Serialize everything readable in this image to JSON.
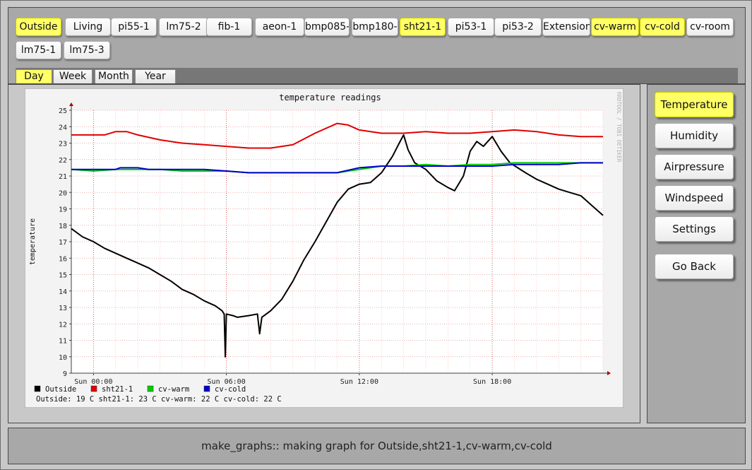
{
  "sensors": [
    {
      "label": "Outside",
      "active": true
    },
    {
      "label": "Living",
      "active": false
    },
    {
      "label": "pi55-1",
      "active": false
    },
    {
      "label": "lm75-2",
      "active": false
    },
    {
      "label": "fib-1",
      "active": false
    },
    {
      "label": "aeon-1",
      "active": false
    },
    {
      "label": "bmp085-",
      "active": false
    },
    {
      "label": "bmp180-",
      "active": false
    },
    {
      "label": "sht21-1",
      "active": true
    },
    {
      "label": "pi53-1",
      "active": false
    },
    {
      "label": "pi53-2",
      "active": false
    },
    {
      "label": "Extension",
      "active": false
    },
    {
      "label": "cv-warm",
      "active": true
    },
    {
      "label": "cv-cold",
      "active": true
    },
    {
      "label": "cv-room",
      "active": false
    },
    {
      "label": "lm75-1",
      "active": false
    },
    {
      "label": "lm75-3",
      "active": false
    }
  ],
  "tabs": [
    {
      "label": "Day",
      "active": true
    },
    {
      "label": "Week",
      "active": false
    },
    {
      "label": "Month",
      "active": false
    },
    {
      "label": "Year",
      "active": false
    }
  ],
  "side_buttons": [
    {
      "label": "Temperature",
      "active": true
    },
    {
      "label": "Humidity",
      "active": false
    },
    {
      "label": "Airpressure",
      "active": false
    },
    {
      "label": "Windspeed",
      "active": false
    },
    {
      "label": "Settings",
      "active": false
    },
    {
      "label": "Go Back",
      "active": false
    }
  ],
  "status_text": "make_graphs:: making graph for Outside,sht21-1,cv-warm,cv-cold",
  "chart_data": {
    "type": "line",
    "title": "temperature readings",
    "ylabel": "temperature",
    "watermark": "RRDTOOL / TOBI OETIKER",
    "ylim": [
      9,
      25
    ],
    "y_ticks": [
      9,
      10,
      11,
      12,
      13,
      14,
      15,
      16,
      17,
      18,
      19,
      20,
      21,
      22,
      23,
      24,
      25
    ],
    "x_range_hours": [
      -1,
      23
    ],
    "x_ticks": [
      {
        "hour": 0,
        "label": "Sun 00:00"
      },
      {
        "hour": 6,
        "label": "Sun 06:00"
      },
      {
        "hour": 12,
        "label": "Sun 12:00"
      },
      {
        "hour": 18,
        "label": "Sun 18:00"
      }
    ],
    "series": [
      {
        "name": "Outside",
        "color": "#000000",
        "points": [
          [
            -1,
            17.8
          ],
          [
            -0.5,
            17.3
          ],
          [
            0,
            17.0
          ],
          [
            0.5,
            16.6
          ],
          [
            1,
            16.3
          ],
          [
            1.5,
            16.0
          ],
          [
            2,
            15.7
          ],
          [
            2.5,
            15.4
          ],
          [
            3,
            15.0
          ],
          [
            3.5,
            14.6
          ],
          [
            4,
            14.1
          ],
          [
            4.5,
            13.8
          ],
          [
            5,
            13.4
          ],
          [
            5.5,
            13.1
          ],
          [
            5.8,
            12.8
          ],
          [
            5.9,
            12.6
          ],
          [
            5.95,
            10.0
          ],
          [
            6.0,
            12.6
          ],
          [
            6.3,
            12.5
          ],
          [
            6.5,
            12.4
          ],
          [
            7,
            12.5
          ],
          [
            7.4,
            12.6
          ],
          [
            7.5,
            11.4
          ],
          [
            7.6,
            12.4
          ],
          [
            8,
            12.8
          ],
          [
            8.5,
            13.5
          ],
          [
            9,
            14.6
          ],
          [
            9.5,
            15.9
          ],
          [
            10,
            17.0
          ],
          [
            10.5,
            18.2
          ],
          [
            11,
            19.4
          ],
          [
            11.5,
            20.2
          ],
          [
            12,
            20.5
          ],
          [
            12.5,
            20.6
          ],
          [
            13,
            21.2
          ],
          [
            13.5,
            22.2
          ],
          [
            13.8,
            23.0
          ],
          [
            14.0,
            23.5
          ],
          [
            14.2,
            22.6
          ],
          [
            14.5,
            21.8
          ],
          [
            15,
            21.4
          ],
          [
            15.5,
            20.7
          ],
          [
            16,
            20.3
          ],
          [
            16.3,
            20.1
          ],
          [
            16.7,
            21.0
          ],
          [
            17,
            22.5
          ],
          [
            17.3,
            23.1
          ],
          [
            17.6,
            22.8
          ],
          [
            18,
            23.4
          ],
          [
            18.4,
            22.5
          ],
          [
            18.8,
            21.8
          ],
          [
            19.5,
            21.2
          ],
          [
            20,
            20.8
          ],
          [
            20.5,
            20.5
          ],
          [
            21,
            20.2
          ],
          [
            21.5,
            20.0
          ],
          [
            22,
            19.8
          ],
          [
            22.5,
            19.2
          ],
          [
            23,
            18.6
          ]
        ]
      },
      {
        "name": "sht21-1",
        "color": "#e00000",
        "points": [
          [
            -1,
            23.5
          ],
          [
            0,
            23.5
          ],
          [
            0.5,
            23.5
          ],
          [
            1,
            23.7
          ],
          [
            1.5,
            23.7
          ],
          [
            2,
            23.5
          ],
          [
            3,
            23.2
          ],
          [
            4,
            23.0
          ],
          [
            5,
            22.9
          ],
          [
            6,
            22.8
          ],
          [
            7,
            22.7
          ],
          [
            8,
            22.7
          ],
          [
            9,
            22.9
          ],
          [
            10,
            23.6
          ],
          [
            11,
            24.2
          ],
          [
            11.5,
            24.1
          ],
          [
            12,
            23.8
          ],
          [
            13,
            23.6
          ],
          [
            14,
            23.6
          ],
          [
            15,
            23.7
          ],
          [
            16,
            23.6
          ],
          [
            17,
            23.6
          ],
          [
            18,
            23.7
          ],
          [
            19,
            23.8
          ],
          [
            20,
            23.7
          ],
          [
            21,
            23.5
          ],
          [
            22,
            23.4
          ],
          [
            23,
            23.4
          ]
        ]
      },
      {
        "name": "cv-warm",
        "color": "#00cc00",
        "points": [
          [
            -1,
            21.4
          ],
          [
            0,
            21.3
          ],
          [
            1,
            21.4
          ],
          [
            1.5,
            21.4
          ],
          [
            2,
            21.4
          ],
          [
            3,
            21.4
          ],
          [
            4,
            21.3
          ],
          [
            5,
            21.3
          ],
          [
            6,
            21.3
          ],
          [
            7,
            21.2
          ],
          [
            8,
            21.2
          ],
          [
            9,
            21.2
          ],
          [
            10,
            21.2
          ],
          [
            11,
            21.2
          ],
          [
            12,
            21.4
          ],
          [
            13,
            21.6
          ],
          [
            14,
            21.6
          ],
          [
            15,
            21.7
          ],
          [
            16,
            21.6
          ],
          [
            17,
            21.7
          ],
          [
            18,
            21.7
          ],
          [
            19,
            21.8
          ],
          [
            20,
            21.8
          ],
          [
            21,
            21.8
          ],
          [
            22,
            21.8
          ],
          [
            23,
            21.8
          ]
        ]
      },
      {
        "name": "cv-cold",
        "color": "#0000cc",
        "points": [
          [
            -1,
            21.4
          ],
          [
            0,
            21.4
          ],
          [
            1,
            21.4
          ],
          [
            1.2,
            21.5
          ],
          [
            2,
            21.5
          ],
          [
            2.5,
            21.4
          ],
          [
            3,
            21.4
          ],
          [
            4,
            21.4
          ],
          [
            5,
            21.4
          ],
          [
            6,
            21.3
          ],
          [
            7,
            21.2
          ],
          [
            8,
            21.2
          ],
          [
            9,
            21.2
          ],
          [
            10,
            21.2
          ],
          [
            11,
            21.2
          ],
          [
            12,
            21.5
          ],
          [
            13,
            21.6
          ],
          [
            14,
            21.6
          ],
          [
            15,
            21.6
          ],
          [
            16,
            21.6
          ],
          [
            17,
            21.6
          ],
          [
            18,
            21.6
          ],
          [
            19,
            21.7
          ],
          [
            20,
            21.7
          ],
          [
            21,
            21.7
          ],
          [
            22,
            21.8
          ],
          [
            23,
            21.8
          ]
        ]
      }
    ],
    "legend": [
      {
        "name": "Outside",
        "color": "#000000"
      },
      {
        "name": "sht21-1",
        "color": "#e00000"
      },
      {
        "name": "cv-warm",
        "color": "#00cc00"
      },
      {
        "name": "cv-cold",
        "color": "#0000cc"
      }
    ],
    "summary": "Outside: 19 C   sht21-1: 23 C   cv-warm: 22 C   cv-cold: 22 C",
    "grid": true,
    "legend_placement": "bottom-left"
  }
}
